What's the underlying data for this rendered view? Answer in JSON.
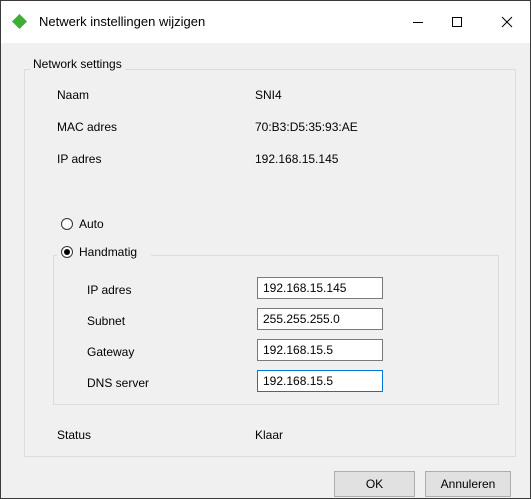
{
  "window": {
    "title": "Netwerk instellingen wijzigen",
    "icon": "green-diamond-icon",
    "controls": [
      "minimize-icon",
      "maximize-icon",
      "close-icon"
    ]
  },
  "network_settings": {
    "legend": "Network settings",
    "naam_label": "Naam",
    "naam_value": "SNI4",
    "mac_label": "MAC adres",
    "mac_value": "70:B3:D5:35:93:AE",
    "ip_label": "IP adres",
    "ip_value": "192.168.15.145"
  },
  "mode": {
    "auto_label": "Auto",
    "manual_label": "Handmatig",
    "selected": "Handmatig"
  },
  "manual": {
    "ip_label": "IP adres",
    "ip_value": "192.168.15.145",
    "subnet_label": "Subnet",
    "subnet_value": "255.255.255.0",
    "gateway_label": "Gateway",
    "gateway_value": "192.168.15.5",
    "dns_label": "DNS server",
    "dns_value": "192.168.15.5"
  },
  "status": {
    "label": "Status",
    "value": "Klaar"
  },
  "buttons": {
    "ok": "OK",
    "cancel": "Annuleren"
  },
  "colors": {
    "icon_green": "#3fae35",
    "focus_border": "#0078d7",
    "window_bg": "#f0f0f0"
  }
}
